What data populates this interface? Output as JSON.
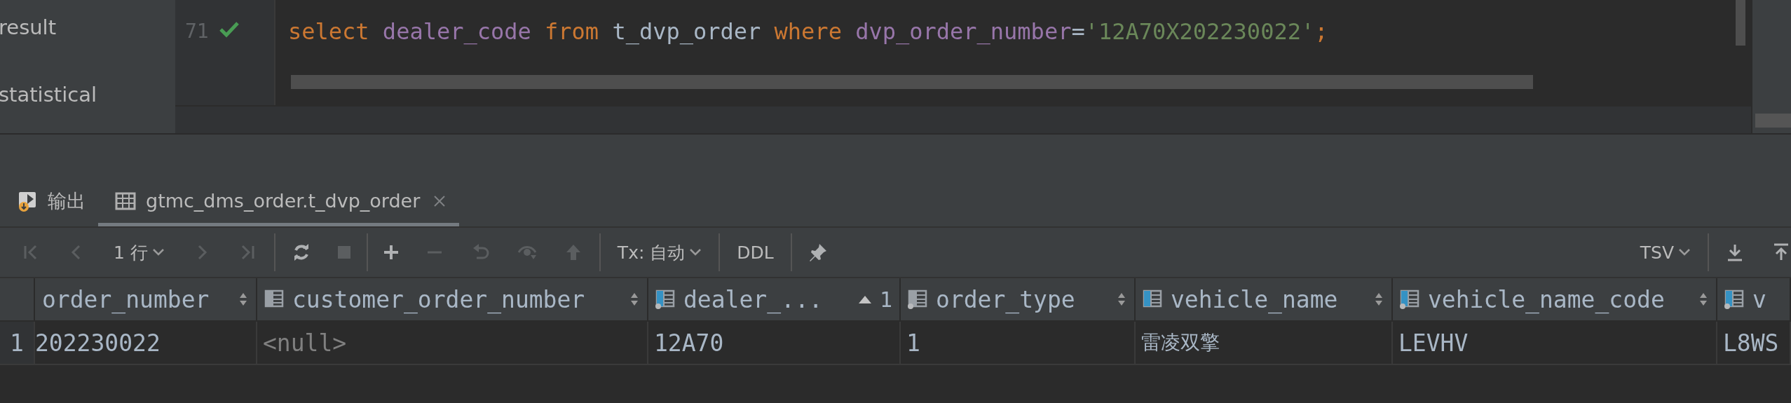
{
  "sidebar": {
    "items": [
      {
        "label": "result"
      },
      {
        "label": "statistical"
      }
    ]
  },
  "editor": {
    "line_number": "71",
    "tokens": [
      {
        "kind": "keyword",
        "text": "select "
      },
      {
        "kind": "column",
        "text": "dealer_code "
      },
      {
        "kind": "keyword",
        "text": "from "
      },
      {
        "kind": "table",
        "text": "t_dvp_order "
      },
      {
        "kind": "keyword",
        "text": "where "
      },
      {
        "kind": "column",
        "text": "dvp_order_number"
      },
      {
        "kind": "operator",
        "text": "="
      },
      {
        "kind": "string",
        "text": "'12A70X202230022'"
      },
      {
        "kind": "punct",
        "text": ";"
      }
    ]
  },
  "tabs": [
    {
      "label": "输出",
      "selected": false
    },
    {
      "label": "gtmc_dms_order.t_dvp_order",
      "selected": true
    }
  ],
  "toolbar": {
    "row_count": "1 行",
    "tx_mode": "Tx: 自动",
    "ddl": "DDL",
    "format": "TSV",
    "buttons": [
      {
        "disabled": true
      },
      {
        "disabled": true
      },
      {
        "disabled": true
      },
      {
        "disabled": true
      },
      {
        "disabled": false
      },
      {
        "disabled": true
      },
      {
        "disabled": false
      },
      {
        "disabled": true
      },
      {
        "disabled": true
      },
      {
        "disabled": true
      },
      {
        "disabled": true
      }
    ]
  },
  "table": {
    "columns": [
      {
        "label": "order_number",
        "sorted": false
      },
      {
        "label": "customer_order_number",
        "kind": "plain",
        "sorted": false
      },
      {
        "label": "dealer_...",
        "kind": "key-indexed",
        "sorted": true,
        "sort_order": "1"
      },
      {
        "label": "order_type",
        "kind": "indexed",
        "sorted": false
      },
      {
        "label": "vehicle_name",
        "kind": "key",
        "sorted": false
      },
      {
        "label": "vehicle_name_code",
        "kind": "key-indexed",
        "sorted": false
      },
      {
        "label": "v",
        "kind": "key-indexed"
      }
    ],
    "rows": [
      {
        "number": "1",
        "cells": [
          {
            "text": "202230022",
            "null": false
          },
          {
            "text": "<null>",
            "null": true
          },
          {
            "text": "12A70",
            "null": false
          },
          {
            "text": "1",
            "null": false
          },
          {
            "text": "雷凌双擎",
            "null": false
          },
          {
            "text": "LEVHV",
            "null": false
          },
          {
            "text": "L8WS",
            "null": false
          }
        ]
      }
    ]
  }
}
